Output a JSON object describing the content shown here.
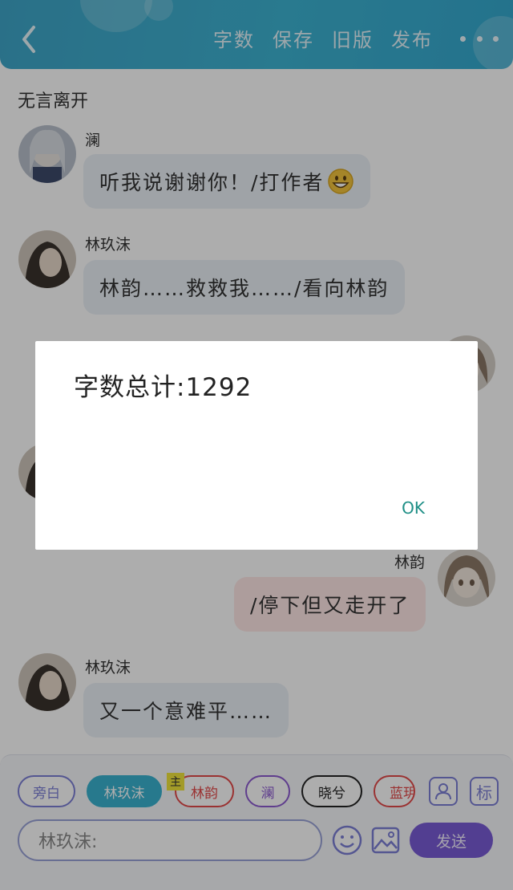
{
  "header": {
    "actions": [
      "字数",
      "保存",
      "旧版",
      "发布"
    ]
  },
  "chat": {
    "title": "无言离开",
    "messages": [
      {
        "sender": "澜",
        "text": "听我说谢谢你！/打作者",
        "side": "left"
      },
      {
        "sender": "林玖沫",
        "text": "林韵……救救我……/看向林韵",
        "side": "left"
      },
      {
        "sender": "林韵",
        "text": "/停下但又走开了",
        "side": "right"
      },
      {
        "sender": "林玖沫",
        "text": "又一个意难平……",
        "side": "left"
      }
    ]
  },
  "input_area": {
    "roles": [
      "旁白",
      "林玖沫",
      "林韵",
      "澜",
      "晓兮",
      "蓝玥"
    ],
    "active_role": "林玖沫",
    "main_badge": "主",
    "side_buttons": [
      "person-icon",
      "标"
    ],
    "input_value": "林玖沫:",
    "send_label": "发送"
  },
  "dialog": {
    "text": "字数总计:1292",
    "ok_label": "OK"
  },
  "colors": {
    "header": "#3db4d3",
    "active_chip": "#3ab3d0",
    "send_button": "#7a5cd6",
    "ok_text": "#1e8f86"
  }
}
